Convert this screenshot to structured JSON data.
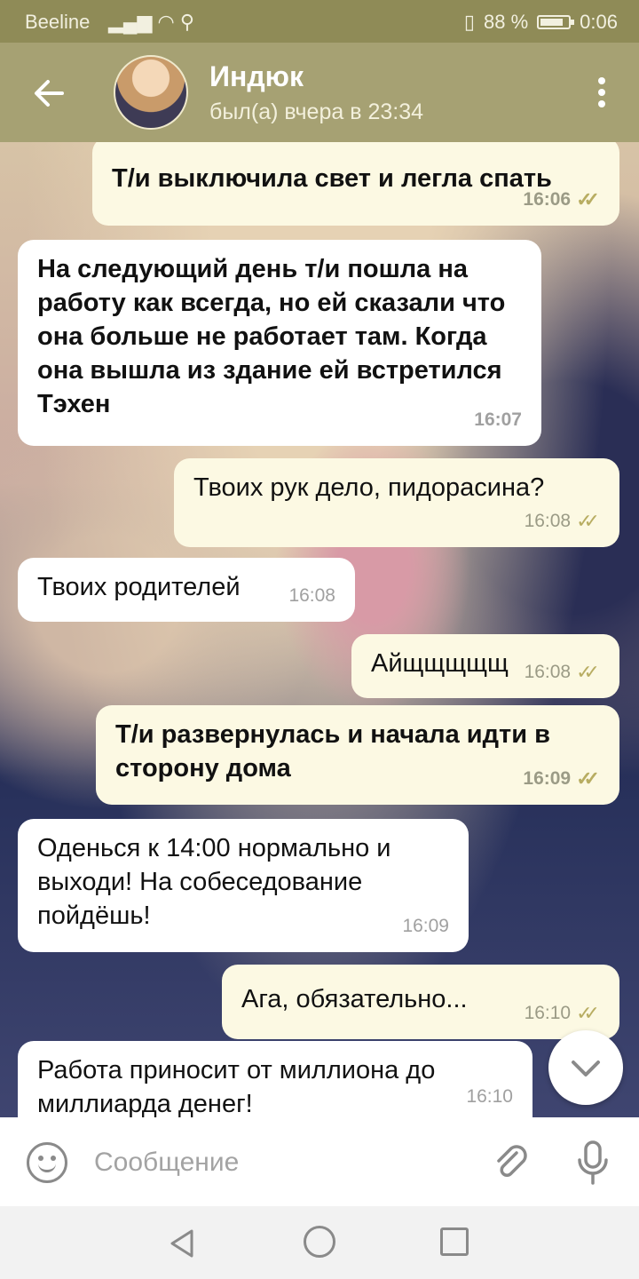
{
  "status_bar": {
    "carrier": "Beeline",
    "battery_percent": "88 %",
    "battery_level": 0.88,
    "time": "0:06"
  },
  "header": {
    "back_icon": "arrow-left-icon",
    "contact_name": "Индюк",
    "last_seen": "был(а) вчера в 23:34",
    "menu_icon": "more-vertical-icon"
  },
  "messages": [
    {
      "dir": "out",
      "text": "Т/и выключила свет и легла спать",
      "time": "16:06",
      "bold": true
    },
    {
      "dir": "in",
      "text": "На следующий день т/и пошла на работу как всегда, но ей сказали что она больше не работает там. Когда она вышла из здание ей встретился Тэхен",
      "time": "16:07",
      "bold": true
    },
    {
      "dir": "out",
      "text": "Твоих рук дело, пидорасина?",
      "time": "16:08"
    },
    {
      "dir": "in",
      "text": "Твоих родителей",
      "time": "16:08"
    },
    {
      "dir": "out",
      "text": "Айщщщщщ",
      "time": "16:08"
    },
    {
      "dir": "out",
      "text": "Т/и развернулась и начала идти в сторону дома",
      "time": "16:09",
      "bold": true
    },
    {
      "dir": "in",
      "text": "Оденься к 14:00 нормально и выходи! На собеседование пойдёшь!",
      "time": "16:09"
    },
    {
      "dir": "out",
      "text": "Ага, обязательно...",
      "time": "16:10"
    },
    {
      "dir": "in",
      "text": "Работа приносит от миллиона до миллиарда денег!",
      "time": "16:10"
    }
  ],
  "input": {
    "placeholder": "Сообщение",
    "emoji_icon": "smile-icon",
    "attach_icon": "paperclip-icon",
    "mic_icon": "microphone-icon"
  },
  "scroll_down_icon": "chevron-down-icon",
  "colors": {
    "header": "#a6a173",
    "status_bar": "#8f8b57",
    "outgoing": "#fcf9e3",
    "incoming": "#ffffff",
    "check": "#b8ad62"
  }
}
